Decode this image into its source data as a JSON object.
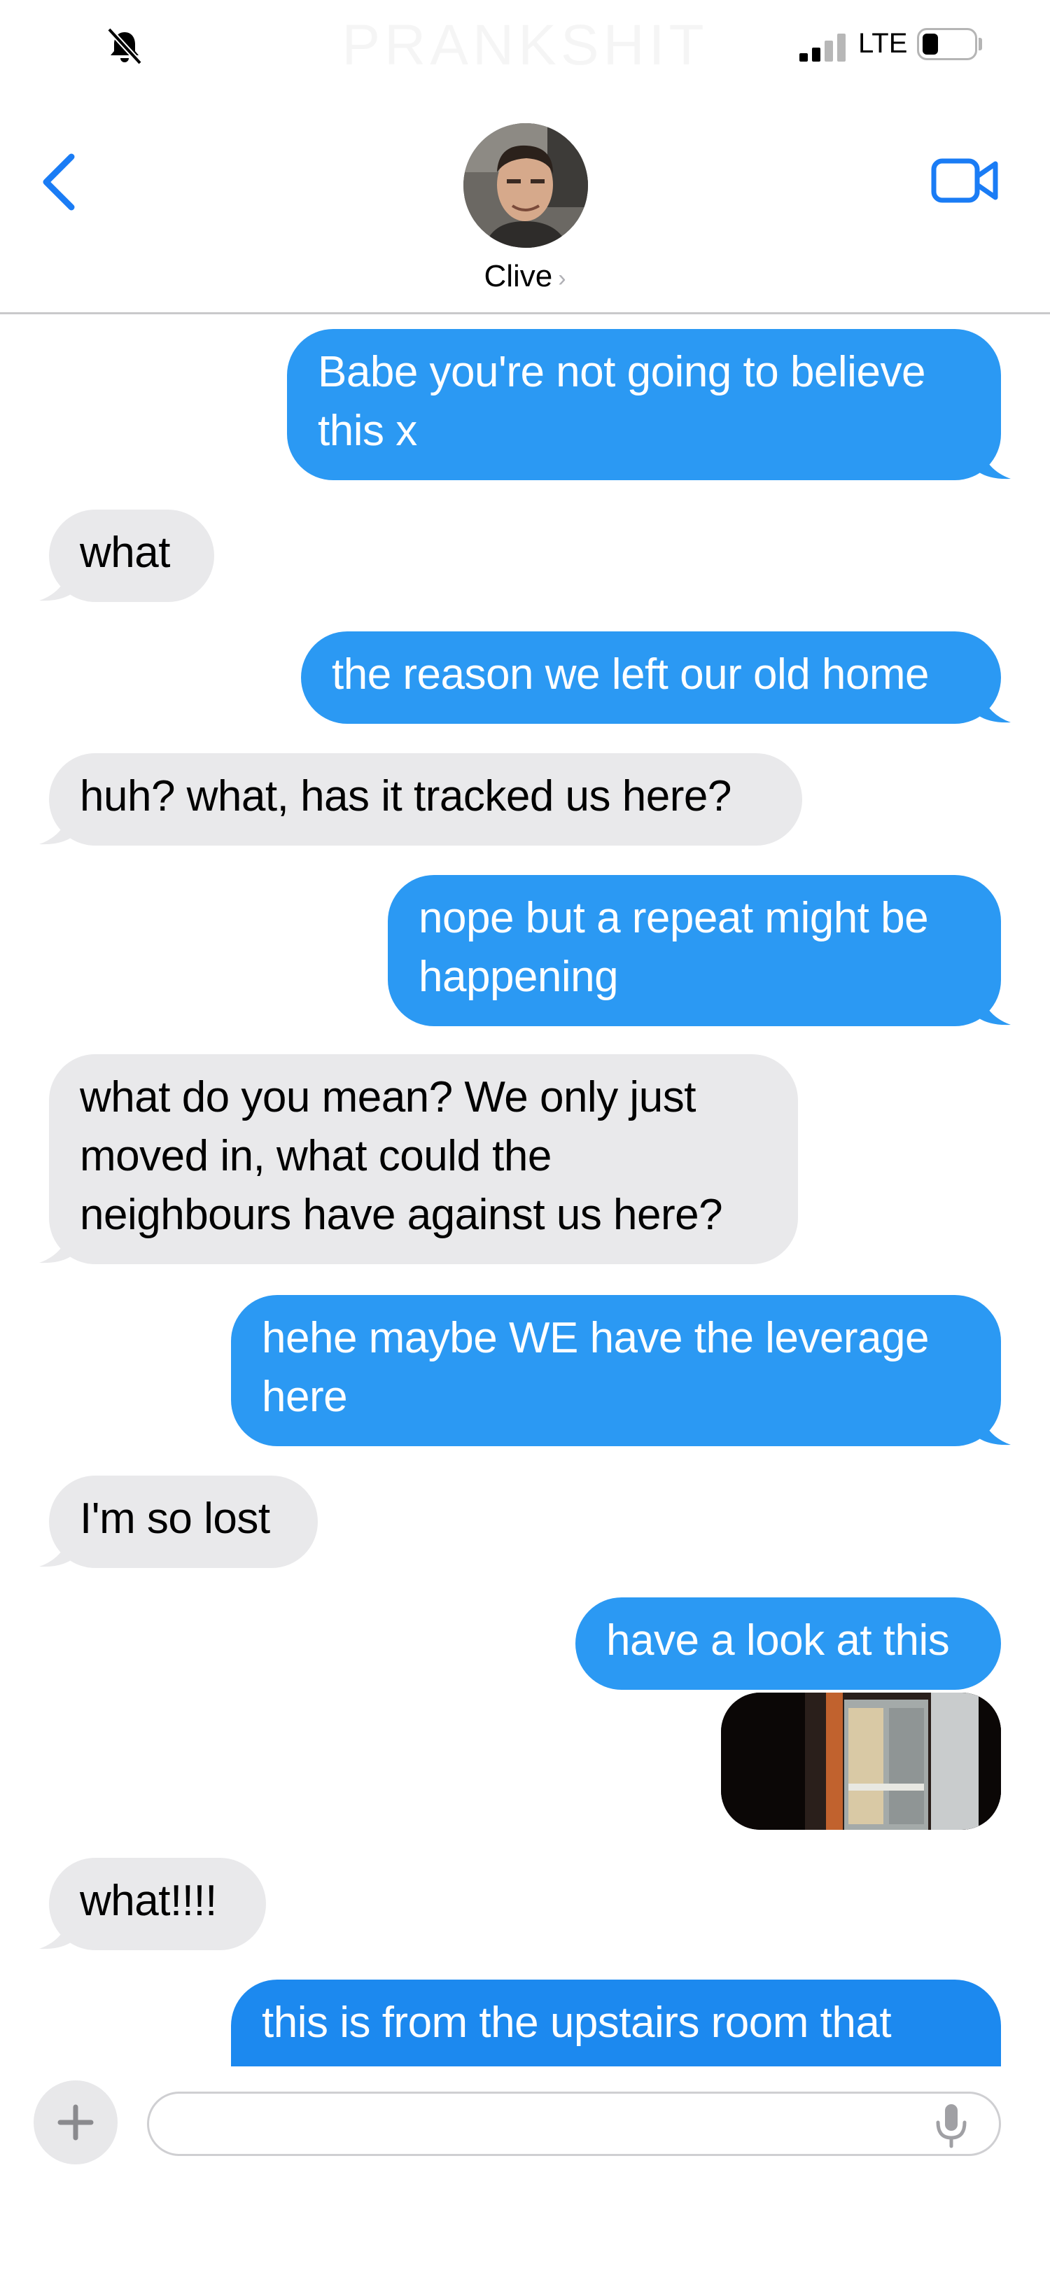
{
  "watermark": "PRANKSHIT",
  "status_bar": {
    "network": "LTE",
    "mute_icon": "bell-slash-icon",
    "signal_icon": "signal-bars-icon",
    "battery_icon": "battery-icon"
  },
  "header": {
    "back_icon": "chevron-left-icon",
    "contact_name": "Clive",
    "contact_chevron": "›",
    "video_icon": "video-camera-icon"
  },
  "messages": [
    {
      "from": "me",
      "lines": [
        "Babe you're not going to believe",
        "this x"
      ]
    },
    {
      "from": "them",
      "lines": [
        "what"
      ]
    },
    {
      "from": "me",
      "lines": [
        "the reason we left our old home"
      ]
    },
    {
      "from": "them",
      "lines": [
        "huh? what, has it tracked us here?"
      ]
    },
    {
      "from": "me",
      "lines": [
        "nope but a repeat might be",
        "happening"
      ]
    },
    {
      "from": "them",
      "lines": [
        "what do you mean? We only just",
        "moved in, what could the",
        "neighbours have against us here?"
      ]
    },
    {
      "from": "me",
      "lines": [
        "hehe maybe WE have the leverage",
        "here"
      ]
    },
    {
      "from": "them",
      "lines": [
        "I'm so lost"
      ]
    },
    {
      "from": "me",
      "lines": [
        "have a look at this"
      ]
    },
    {
      "from": "me",
      "type": "photo",
      "description_icon": "photo-thumbnail"
    },
    {
      "from": "them",
      "lines": [
        "what!!!!"
      ]
    },
    {
      "from": "me",
      "lines": [
        "this is from the upstairs room that"
      ]
    }
  ],
  "input": {
    "plus_icon": "plus-icon",
    "placeholder": "",
    "mic_icon": "microphone-icon"
  },
  "colors": {
    "sent_bubble": "#2b99f3",
    "received_bubble": "#e9e9eb",
    "accent": "#1a7cf5"
  }
}
